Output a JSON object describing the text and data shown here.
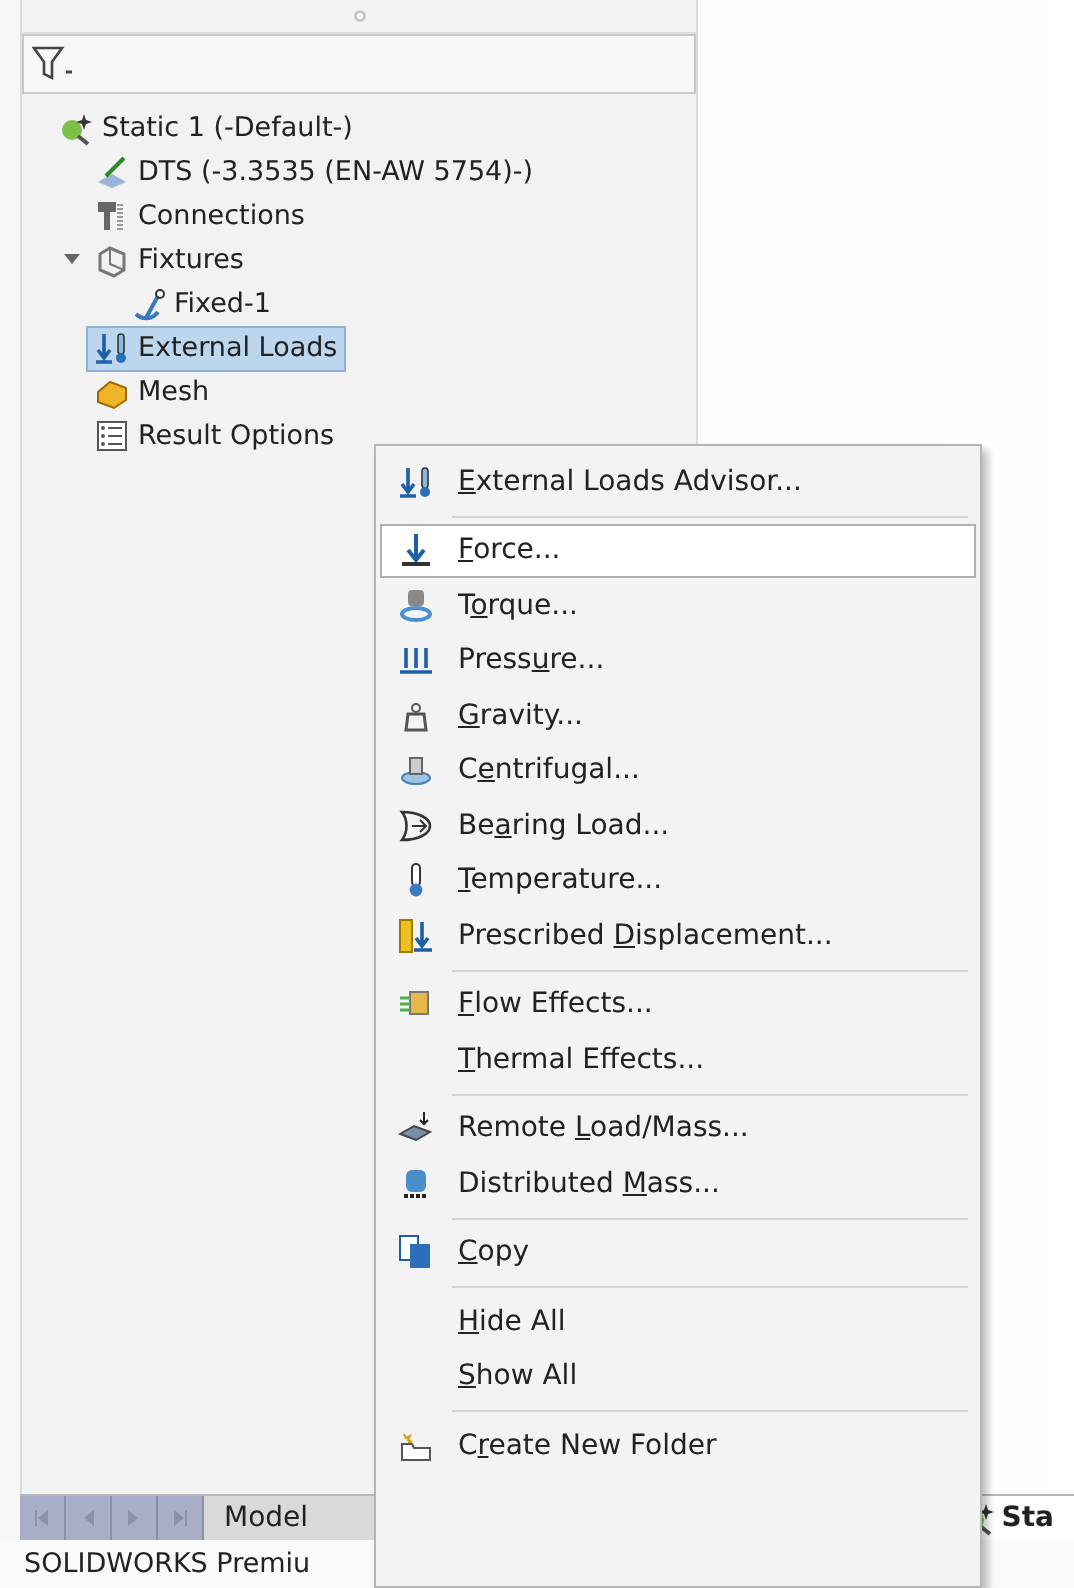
{
  "tree": {
    "label": "Static 1 (-Default-)",
    "selected": false,
    "children": [
      {
        "label": "DTS (-3.3535 (EN-AW 5754)-)",
        "selected": false
      },
      {
        "label": "Connections",
        "selected": false
      },
      {
        "label": "Fixtures",
        "selected": false,
        "expanded": true,
        "children": [
          {
            "label": "Fixed-1",
            "selected": false
          }
        ]
      },
      {
        "label": "External Loads",
        "selected": true
      },
      {
        "label": "Mesh",
        "selected": false
      },
      {
        "label": "Result Options",
        "selected": false
      }
    ]
  },
  "context_menu": [
    {
      "kind": "item",
      "key": "E",
      "post": "xternal Loads Advisor...",
      "selected": false
    },
    {
      "kind": "separator"
    },
    {
      "kind": "item",
      "key": "F",
      "post": "orce...",
      "selected": true
    },
    {
      "kind": "item",
      "pre": "T",
      "key": "o",
      "post": "rque...",
      "selected": false
    },
    {
      "kind": "item",
      "pre": "Press",
      "key": "u",
      "post": "re...",
      "selected": false
    },
    {
      "kind": "item",
      "key": "G",
      "post": "ravity...",
      "selected": false
    },
    {
      "kind": "item",
      "pre": "C",
      "key": "e",
      "post": "ntrifugal...",
      "selected": false
    },
    {
      "kind": "item",
      "pre": "Be",
      "key": "a",
      "post": "ring Load...",
      "selected": false
    },
    {
      "kind": "item",
      "key": "T",
      "post": "emperature...",
      "selected": false
    },
    {
      "kind": "item",
      "pre": "Prescribed ",
      "key": "D",
      "post": "isplacement...",
      "selected": false
    },
    {
      "kind": "separator"
    },
    {
      "kind": "item",
      "key": "F",
      "post": "low Effects...",
      "selected": false
    },
    {
      "kind": "item",
      "key": "T",
      "post": "hermal Effects...",
      "selected": false
    },
    {
      "kind": "separator"
    },
    {
      "kind": "item",
      "pre": "Remote ",
      "key": "L",
      "post": "oad/Mass...",
      "selected": false
    },
    {
      "kind": "item",
      "pre": "Distributed ",
      "key": "M",
      "post": "ass...",
      "selected": false
    },
    {
      "kind": "separator"
    },
    {
      "kind": "item",
      "key": "C",
      "post": "opy",
      "selected": false
    },
    {
      "kind": "separator"
    },
    {
      "kind": "item",
      "key": "H",
      "post": "ide All",
      "selected": false
    },
    {
      "kind": "item",
      "key": "S",
      "post": "how All",
      "selected": false
    },
    {
      "kind": "separator"
    },
    {
      "kind": "item",
      "pre": "C",
      "key": "r",
      "post": "eate New Folder",
      "selected": false
    }
  ],
  "bottom_tabs": [
    {
      "label": "Model",
      "selected": false
    },
    {
      "label": "Sta",
      "selected": true
    }
  ],
  "status_bar": "SOLIDWORKS Premiu"
}
